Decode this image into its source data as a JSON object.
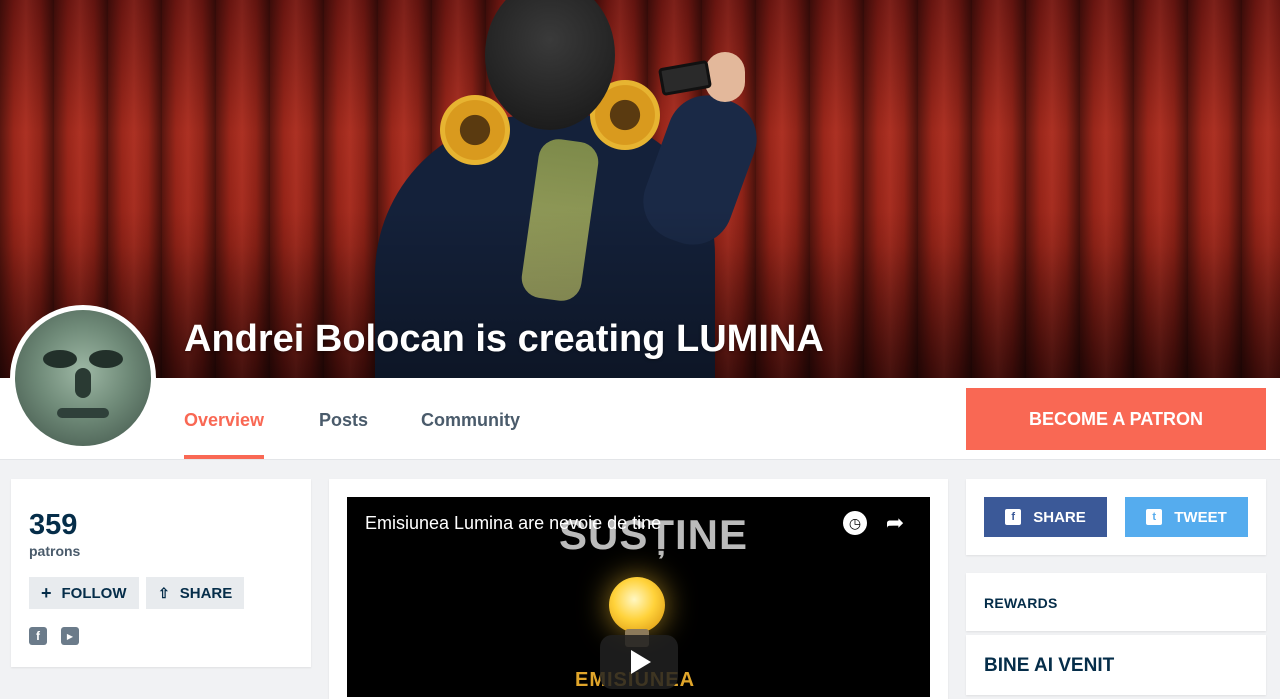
{
  "creator": {
    "name": "Andrei Bolocan",
    "creating_text": "is creating LUMINA"
  },
  "nav": {
    "tabs": [
      {
        "label": "Overview",
        "active": true
      },
      {
        "label": "Posts",
        "active": false
      },
      {
        "label": "Community",
        "active": false
      }
    ],
    "become_patron_label": "BECOME A PATRON"
  },
  "stats": {
    "patron_count": "359",
    "patron_label": "patrons",
    "follow_label": "FOLLOW",
    "share_label": "SHARE",
    "social_icons": [
      "facebook-icon",
      "youtube-icon"
    ]
  },
  "video": {
    "title": "Emisiunea Lumina are nevoie de tine",
    "overlay_word": "SUSȚINE",
    "bottom_word": "EMISIUNEA"
  },
  "share_card": {
    "share_label": "SHARE",
    "tweet_label": "TWEET"
  },
  "rewards": {
    "label": "REWARDS",
    "first_tier_title": "BINE AI VENIT"
  },
  "colors": {
    "accent": "#f96854",
    "navy": "#052d49",
    "facebook": "#3b5998",
    "twitter": "#55acee"
  }
}
